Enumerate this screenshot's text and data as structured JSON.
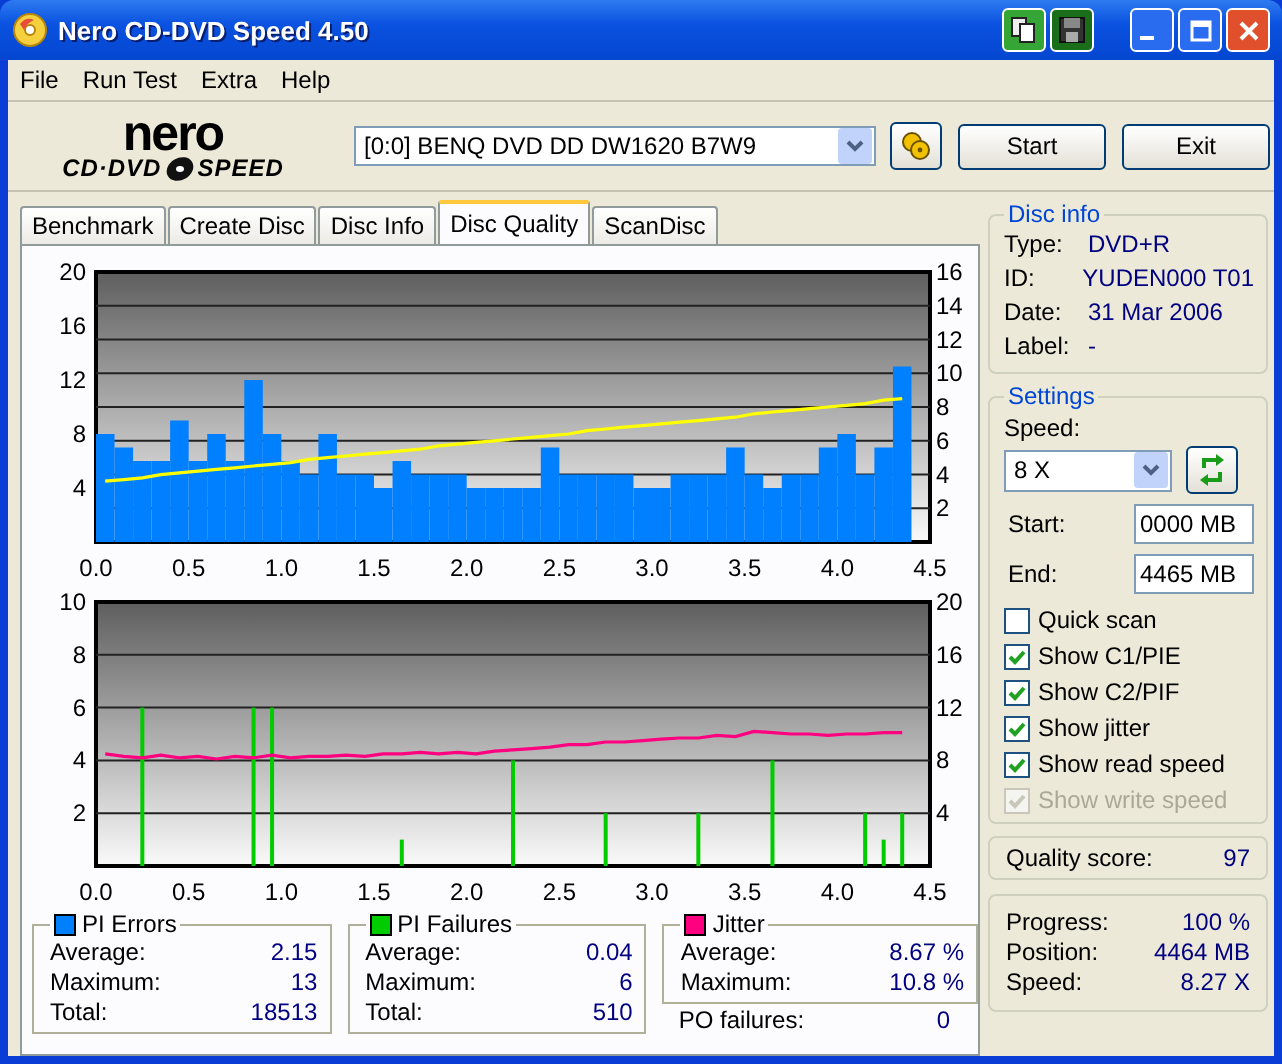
{
  "window": {
    "title": "Nero CD-DVD Speed 4.50"
  },
  "menu": [
    "File",
    "Run Test",
    "Extra",
    "Help"
  ],
  "logo": {
    "brand": "nero",
    "product": "CD·DVD",
    "product2": "SPEED"
  },
  "toolbar": {
    "drive": "[0:0]   BENQ DVD DD DW1620 B7W9",
    "buttons": [
      "Start",
      "Exit"
    ]
  },
  "tabs": [
    {
      "label": "Benchmark",
      "selected": false
    },
    {
      "label": "Create Disc",
      "selected": false
    },
    {
      "label": "Disc Info",
      "selected": false
    },
    {
      "label": "Disc Quality",
      "selected": true
    },
    {
      "label": "ScanDisc",
      "selected": false
    }
  ],
  "charts": [
    {
      "chart_data": {
        "type": "bar",
        "grid": true,
        "x": [
          0.05,
          0.15,
          0.25,
          0.35,
          0.45,
          0.55,
          0.65,
          0.75,
          0.85,
          0.95,
          1.05,
          1.15,
          1.25,
          1.35,
          1.45,
          1.55,
          1.65,
          1.75,
          1.85,
          1.95,
          2.05,
          2.15,
          2.25,
          2.35,
          2.45,
          2.55,
          2.65,
          2.75,
          2.85,
          2.95,
          3.05,
          3.15,
          3.25,
          3.35,
          3.45,
          3.55,
          3.65,
          3.75,
          3.85,
          3.95,
          4.05,
          4.15,
          4.25,
          4.35
        ],
        "xlim": [
          0,
          4.5
        ],
        "ylim": [
          0,
          20
        ],
        "y2lim": [
          0,
          16
        ],
        "xticks": [
          {
            "value": 0,
            "label": "0.0"
          },
          {
            "value": 0.5,
            "label": "0.5"
          },
          {
            "value": 1,
            "label": "1.0"
          },
          {
            "value": 1.5,
            "label": "1.5"
          },
          {
            "value": 2,
            "label": "2.0"
          },
          {
            "value": 2.5,
            "label": "2.5"
          },
          {
            "value": 3,
            "label": "3.0"
          },
          {
            "value": 3.5,
            "label": "3.5"
          },
          {
            "value": 4,
            "label": "4.0"
          },
          {
            "value": 4.5,
            "label": "4.5"
          }
        ],
        "yticks": [
          4,
          8,
          12,
          16,
          20
        ],
        "y2ticks": [
          2,
          4,
          6,
          8,
          10,
          12,
          14,
          16
        ],
        "series": [
          {
            "axis": "y",
            "color": "#0080ff",
            "values": [
              8,
              7,
              6,
              6,
              9,
              6,
              8,
              6,
              12,
              8,
              6,
              5,
              8,
              5,
              5,
              4,
              6,
              5,
              5,
              5,
              4,
              4,
              4,
              4,
              7,
              5,
              5,
              5,
              5,
              4,
              4,
              5,
              5,
              5,
              7,
              5,
              4,
              5,
              5,
              7,
              8,
              5,
              7,
              13
            ]
          },
          {
            "type": "line",
            "axis": "y2",
            "color": "#ffff00",
            "values": [
              3.6,
              3.7,
              3.8,
              4.0,
              4.1,
              4.2,
              4.3,
              4.4,
              4.5,
              4.6,
              4.7,
              4.9,
              5.0,
              5.1,
              5.2,
              5.3,
              5.4,
              5.5,
              5.7,
              5.8,
              5.9,
              6.0,
              6.1,
              6.2,
              6.3,
              6.4,
              6.6,
              6.7,
              6.8,
              6.9,
              7.0,
              7.1,
              7.2,
              7.3,
              7.4,
              7.6,
              7.7,
              7.8,
              7.9,
              8.0,
              8.1,
              8.2,
              8.4,
              8.5
            ]
          }
        ]
      }
    },
    {
      "chart_data": {
        "type": "bar",
        "grid": true,
        "x": [
          0.05,
          0.15,
          0.25,
          0.35,
          0.45,
          0.55,
          0.65,
          0.75,
          0.85,
          0.95,
          1.05,
          1.15,
          1.25,
          1.35,
          1.45,
          1.55,
          1.65,
          1.75,
          1.85,
          1.95,
          2.05,
          2.15,
          2.25,
          2.35,
          2.45,
          2.55,
          2.65,
          2.75,
          2.85,
          2.95,
          3.05,
          3.15,
          3.25,
          3.35,
          3.45,
          3.55,
          3.65,
          3.75,
          3.85,
          3.95,
          4.05,
          4.15,
          4.25,
          4.35
        ],
        "xlim": [
          0,
          4.5
        ],
        "ylim": [
          0,
          10
        ],
        "y2lim": [
          0,
          20
        ],
        "xticks": [
          {
            "value": 0,
            "label": "0.0"
          },
          {
            "value": 0.5,
            "label": "0.5"
          },
          {
            "value": 1,
            "label": "1.0"
          },
          {
            "value": 1.5,
            "label": "1.5"
          },
          {
            "value": 2,
            "label": "2.0"
          },
          {
            "value": 2.5,
            "label": "2.5"
          },
          {
            "value": 3,
            "label": "3.0"
          },
          {
            "value": 3.5,
            "label": "3.5"
          },
          {
            "value": 4,
            "label": "4.0"
          },
          {
            "value": 4.5,
            "label": "4.5"
          }
        ],
        "yticks": [
          2,
          4,
          6,
          8,
          10
        ],
        "y2ticks": [
          4,
          8,
          12,
          16,
          20
        ],
        "series": [
          {
            "axis": "y",
            "color": "#00cc00",
            "values": [
              0,
              0,
              6,
              0,
              0,
              0,
              0,
              0,
              6,
              6,
              0,
              0,
              0,
              0,
              0,
              0,
              1,
              0,
              0,
              0,
              0,
              0,
              4,
              0,
              0,
              0,
              0,
              2,
              0,
              0,
              0,
              0,
              2,
              0,
              0,
              0,
              4,
              0,
              0,
              0,
              0,
              2,
              1,
              2
            ]
          },
          {
            "type": "line",
            "axis": "y2",
            "color": "#ff0080",
            "values": [
              8.5,
              8.3,
              8.2,
              8.4,
              8.2,
              8.3,
              8.1,
              8.3,
              8.2,
              8.4,
              8.2,
              8.3,
              8.3,
              8.4,
              8.3,
              8.5,
              8.5,
              8.6,
              8.5,
              8.6,
              8.5,
              8.7,
              8.8,
              8.9,
              9.0,
              9.2,
              9.2,
              9.4,
              9.4,
              9.5,
              9.6,
              9.7,
              9.7,
              9.9,
              9.8,
              10.2,
              10.1,
              10.0,
              10.0,
              9.9,
              10.0,
              10.0,
              10.1,
              10.1
            ]
          }
        ]
      }
    }
  ],
  "stats": [
    {
      "title": "PI Errors",
      "color": "#0080ff",
      "rows": [
        {
          "label": "Average:",
          "value": "2.15"
        },
        {
          "label": "Maximum:",
          "value": "13"
        },
        {
          "label": "Total:",
          "value": "18513"
        }
      ]
    },
    {
      "title": "PI Failures",
      "color": "#00cc00",
      "rows": [
        {
          "label": "Average:",
          "value": "0.04"
        },
        {
          "label": "Maximum:",
          "value": "6"
        },
        {
          "label": "Total:",
          "value": "510"
        }
      ]
    },
    {
      "title": "Jitter",
      "color": "#ff0080",
      "rows": [
        {
          "label": "Average:",
          "value": "8.67 %"
        },
        {
          "label": "Maximum:",
          "value": "10.8 %"
        }
      ]
    }
  ],
  "po_failures": {
    "label": "PO failures:",
    "value": "0"
  },
  "disc_info": {
    "title": "Disc info",
    "rows": [
      {
        "label": "Type:",
        "value": "DVD+R"
      },
      {
        "label": "ID:",
        "value": "YUDEN000 T01"
      },
      {
        "label": "Date:",
        "value": "31 Mar 2006"
      },
      {
        "label": "Label:",
        "value": "-"
      }
    ]
  },
  "settings": {
    "title": "Settings",
    "speed_label": "Speed:",
    "speed_value": "8 X",
    "start_label": "Start:",
    "start_value": "0000 MB",
    "end_label": "End:",
    "end_value": "4465 MB",
    "options": [
      {
        "label": "Quick scan",
        "checked": false,
        "disabled": false
      },
      {
        "label": "Show C1/PIE",
        "checked": true,
        "disabled": false
      },
      {
        "label": "Show C2/PIF",
        "checked": true,
        "disabled": false
      },
      {
        "label": "Show jitter",
        "checked": true,
        "disabled": false
      },
      {
        "label": "Show read speed",
        "checked": true,
        "disabled": false
      },
      {
        "label": "Show write speed",
        "checked": true,
        "disabled": true
      }
    ]
  },
  "quality": {
    "label": "Quality score:",
    "value": "97"
  },
  "progress": [
    {
      "label": "Progress:",
      "value": "100 %"
    },
    {
      "label": "Position:",
      "value": "4464 MB"
    },
    {
      "label": "Speed:",
      "value": "8.27 X"
    }
  ]
}
